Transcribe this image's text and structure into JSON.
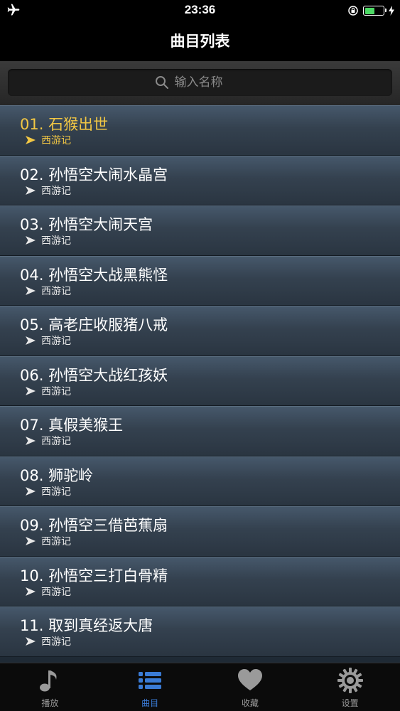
{
  "status_bar": {
    "time": "23:36",
    "battery_level": 0.55,
    "battery_color": "#4cd964"
  },
  "nav": {
    "title": "曲目列表"
  },
  "search": {
    "placeholder": "输入名称",
    "value": ""
  },
  "colors": {
    "active_text": "#f2c744",
    "tab_active": "#3a7bd5",
    "tab_inactive": "#9a9a9a"
  },
  "songs": [
    {
      "title": "01. 石猴出世",
      "album": "西游记",
      "active": true
    },
    {
      "title": "02. 孙悟空大闹水晶宫",
      "album": "西游记",
      "active": false
    },
    {
      "title": "03. 孙悟空大闹天宫",
      "album": "西游记",
      "active": false
    },
    {
      "title": "04. 孙悟空大战黑熊怪",
      "album": "西游记",
      "active": false
    },
    {
      "title": "05. 高老庄收服猪八戒",
      "album": "西游记",
      "active": false
    },
    {
      "title": "06. 孙悟空大战红孩妖",
      "album": "西游记",
      "active": false
    },
    {
      "title": "07. 真假美猴王",
      "album": "西游记",
      "active": false
    },
    {
      "title": "08. 狮驼岭",
      "album": "西游记",
      "active": false
    },
    {
      "title": "09. 孙悟空三借芭蕉扇",
      "album": "西游记",
      "active": false
    },
    {
      "title": "10. 孙悟空三打白骨精",
      "album": "西游记",
      "active": false
    },
    {
      "title": "11. 取到真经返大唐",
      "album": "西游记",
      "active": false
    }
  ],
  "tabs": [
    {
      "label": "播放",
      "icon": "music-note-icon",
      "active": false
    },
    {
      "label": "曲目",
      "icon": "list-icon",
      "active": true
    },
    {
      "label": "收藏",
      "icon": "heart-icon",
      "active": false
    },
    {
      "label": "设置",
      "icon": "gear-icon",
      "active": false
    }
  ]
}
